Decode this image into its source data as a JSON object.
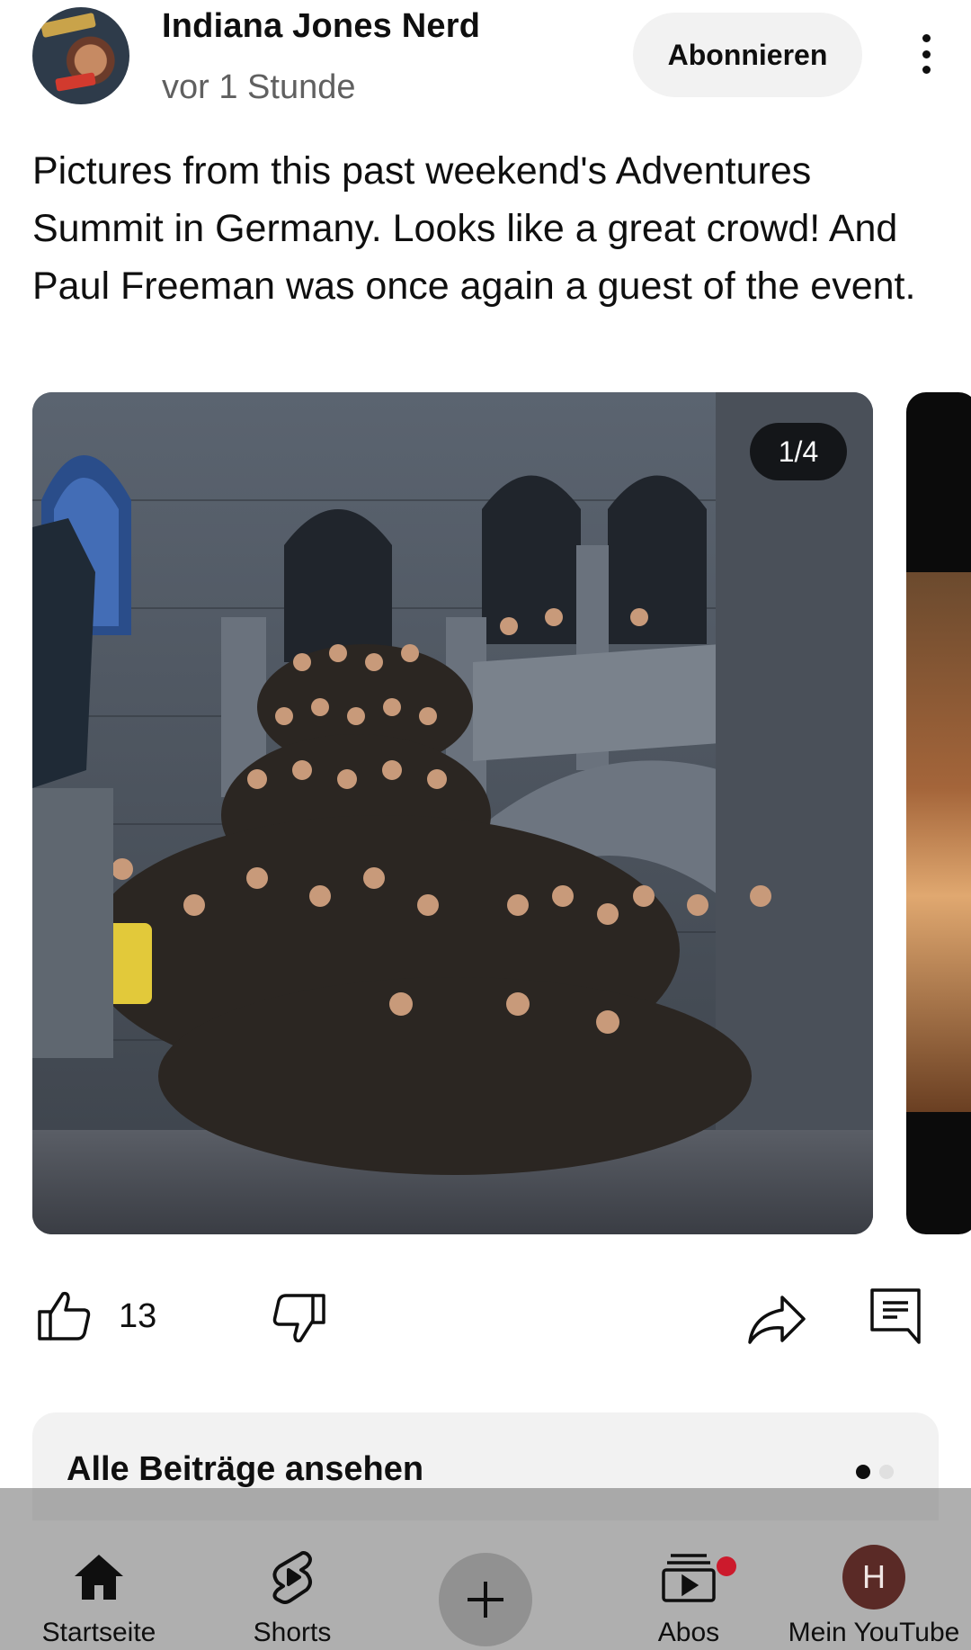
{
  "post": {
    "channel_name": "Indiana Jones Nerd",
    "time_ago": "vor 1 Stunde",
    "subscribe_label": "Abonnieren",
    "text": "Pictures from this past weekend's Adventures Summit in Germany. Looks like a great crowd! And Paul Freeman was once again a guest of the event.",
    "image_counter": "1/4",
    "like_count": "13"
  },
  "all_posts": {
    "label": "Alle Beiträge ansehen",
    "page_count": 2,
    "active_page": 1
  },
  "nav": {
    "items": [
      {
        "label": "Startseite",
        "icon": "home-icon"
      },
      {
        "label": "Shorts",
        "icon": "shorts-icon"
      },
      {
        "label": "",
        "icon": "create-plus-icon"
      },
      {
        "label": "Abos",
        "icon": "subscriptions-icon"
      },
      {
        "label": "Mein YouTube",
        "icon": "profile-avatar",
        "avatar_letter": "H"
      }
    ]
  },
  "colors": {
    "text": "#0f0f0f",
    "secondary_text": "#606060",
    "chip_bg": "#f2f2f2",
    "notification_dot": "#cc1a2c",
    "avatar_bg": "#5a2a26"
  }
}
